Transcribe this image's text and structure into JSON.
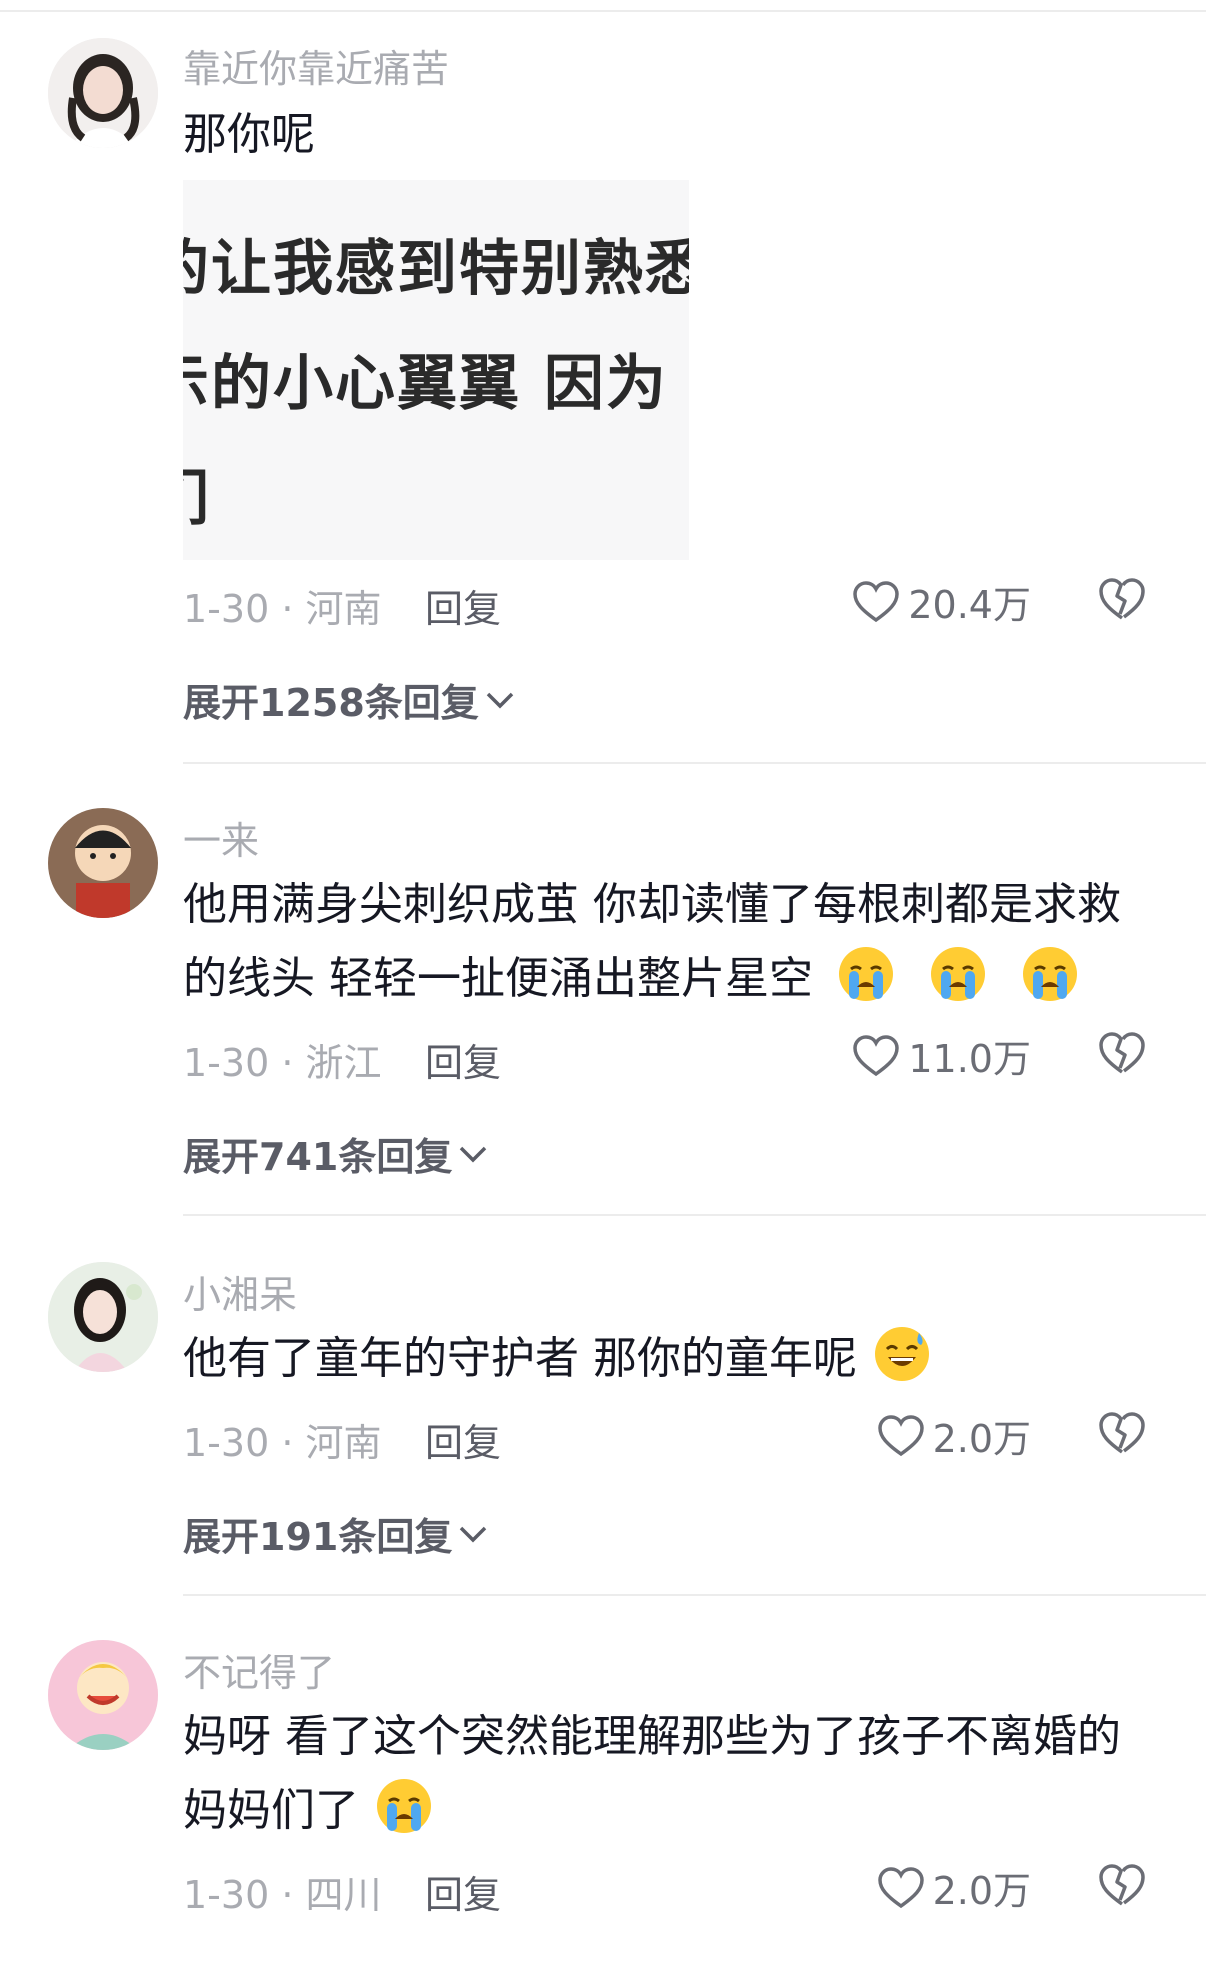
{
  "comments": [
    {
      "username": "靠近你靠近痛苦",
      "text": "那你呢",
      "image_lines": [
        "的让我感到特别熟悉",
        "示的小心翼翼  因为",
        "们"
      ],
      "date_location": "1-30 · 河南",
      "reply_label": "回复",
      "likes": "20.4万",
      "expand_label": "展开1258条回复"
    },
    {
      "username": "一来",
      "text_line1": "他用满身尖刺织成茧 你却读懂了每根刺都是求救",
      "text_line2": "的线头 轻轻一扯便涌出整片星空",
      "emoji": [
        "loudly-crying-emoji",
        "loudly-crying-emoji",
        "loudly-crying-emoji"
      ],
      "date_location": "1-30 · 浙江",
      "reply_label": "回复",
      "likes": "11.0万",
      "expand_label": "展开741条回复"
    },
    {
      "username": "小湘呆",
      "text": "他有了童年的守护者 那你的童年呢",
      "emoji": [
        "sweat-smile-emoji"
      ],
      "date_location": "1-30 · 河南",
      "reply_label": "回复",
      "likes": "2.0万",
      "expand_label": "展开191条回复"
    },
    {
      "username": "不记得了",
      "text_line1": "妈呀 看了这个突然能理解那些为了孩子不离婚的",
      "text_line2": "妈妈们了",
      "emoji": [
        "loudly-crying-emoji"
      ],
      "date_location": "1-30 · 四川",
      "reply_label": "回复",
      "likes": "2.0万"
    }
  ],
  "colors": {
    "username": "#a9abb1",
    "text": "#161823",
    "meta": "#a9abb1",
    "divider": "#ececec"
  }
}
